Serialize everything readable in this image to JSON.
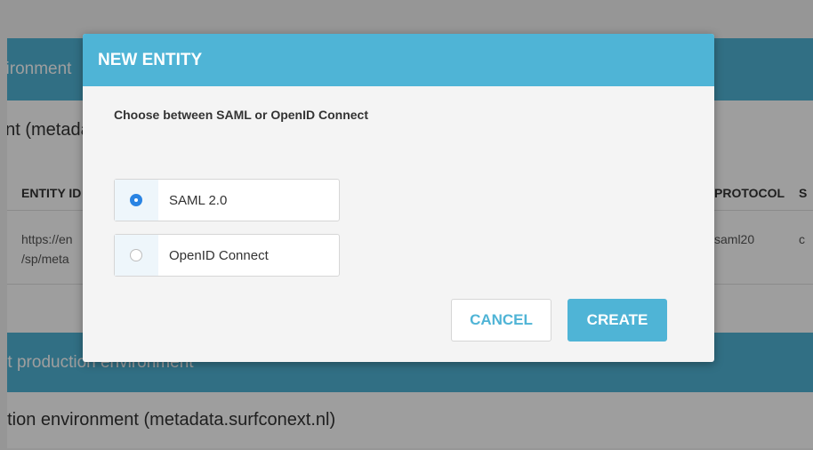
{
  "background": {
    "test_env_header": "SURFconext test environment",
    "test_env_section": "SURFconext test environment (metadata.test.surfconext.nl)",
    "table_headers": {
      "entity_id": "ENTITY ID",
      "protocol": "PROTOCOL",
      "state_initial": "S"
    },
    "table_row": {
      "entity_id_line1": "https://en",
      "entity_id_line2": "/sp/meta",
      "protocol": "saml20",
      "state_initial": "c"
    },
    "prod_env_header": "SURFconext production environment",
    "prod_env_section": "SURFconext production environment (metadata.surfconext.nl)"
  },
  "modal": {
    "title": "NEW ENTITY",
    "subtitle": "Choose between SAML or OpenID Connect",
    "options": [
      {
        "label": "SAML 2.0",
        "checked": true
      },
      {
        "label": "OpenID Connect",
        "checked": false
      }
    ],
    "cancel_label": "CANCEL",
    "create_label": "CREATE"
  },
  "colors": {
    "accent": "#4fb4d6",
    "radio_selected": "#2a84e3"
  }
}
